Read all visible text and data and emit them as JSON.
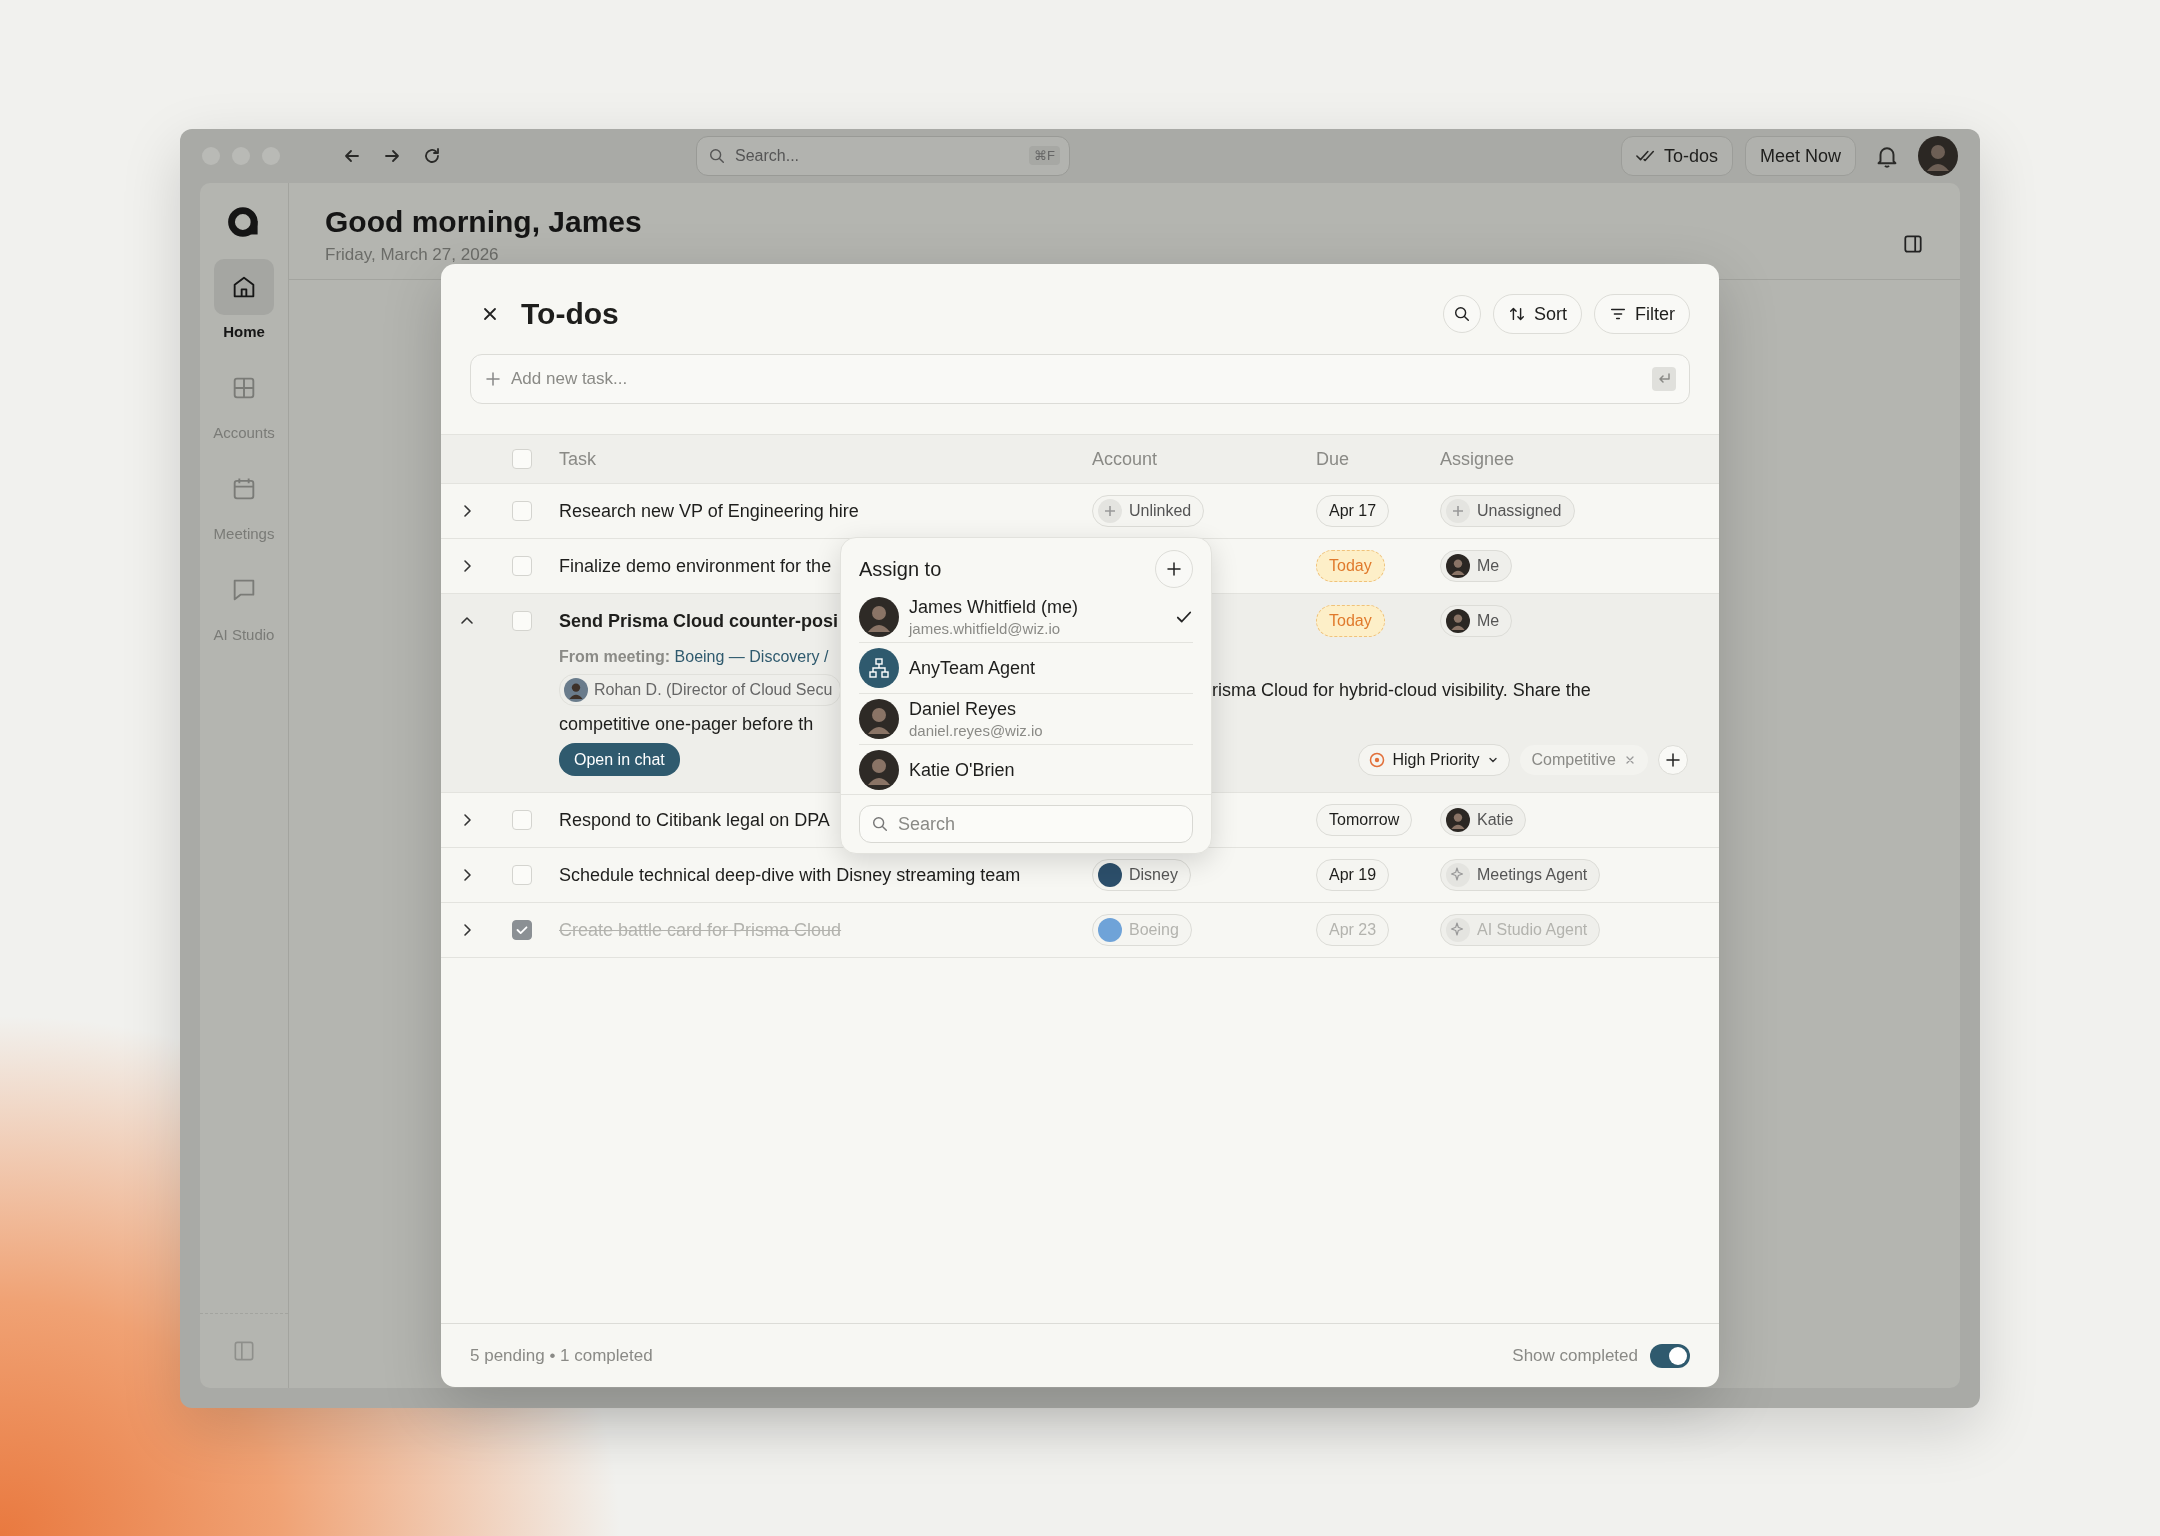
{
  "titlebar": {
    "search": {
      "placeholder": "Search...",
      "shortcut": "⌘F"
    },
    "buttons": [
      {
        "label": "To-dos",
        "kind": "todos"
      },
      {
        "label": "Meet Now",
        "kind": "plain"
      }
    ]
  },
  "sidebar": {
    "items": [
      {
        "label": "Home",
        "kind": "home",
        "selected": true
      },
      {
        "label": "Accounts",
        "kind": "accounts",
        "selected": false
      },
      {
        "label": "Meetings",
        "kind": "meetings",
        "selected": false
      },
      {
        "label": "AI Studio",
        "kind": "chat",
        "selected": false
      }
    ]
  },
  "header": {
    "greeting": "Good morning, James",
    "date": "Friday, March 27, 2026"
  },
  "todos": {
    "title": "To-dos",
    "toolbar": [
      {
        "label": "Sort",
        "kind": "sort"
      },
      {
        "label": "Filter",
        "kind": "filter"
      }
    ],
    "new_task": {
      "placeholder": "Add new task..."
    },
    "columns": [
      "Task",
      "Account",
      "Due",
      "Assignee"
    ],
    "select_all": {
      "checked": false
    },
    "rows": [
      {
        "task": "Research new VP of Engineering hire",
        "checked": false,
        "expanded": false,
        "account": {
          "label": "Unlinked",
          "kind": "unlinked"
        },
        "due": {
          "label": "Apr 17",
          "kind": "date"
        },
        "assignee": {
          "label": "Unassigned",
          "kind": "unassigned"
        }
      },
      {
        "task": "Finalize demo environment for the",
        "checked": false,
        "expanded": false,
        "due": {
          "label": "Today",
          "kind": "today"
        },
        "assignee": {
          "label": "Me",
          "kind": "person"
        }
      },
      {
        "task": "Send Prisma Cloud counter-posi",
        "checked": false,
        "expanded": true,
        "due": {
          "label": "Today",
          "kind": "today"
        },
        "assignee": {
          "label": "Me",
          "kind": "person"
        },
        "details": {
          "meeting_label": "From meeting:",
          "meeting_link": "Boeing — Discovery /",
          "quote_person": "Rohan D. (Director of Cloud Secu",
          "text_right": "risma Cloud for hybrid-cloud visibility. Share the",
          "text_line2": "competitive one-pager before th",
          "action": "Open in chat",
          "priority": "High Priority",
          "tags": [
            "Competitive"
          ]
        }
      },
      {
        "task": "Respond to Citibank legal on DPA",
        "checked": false,
        "expanded": false,
        "due": {
          "label": "Tomorrow",
          "kind": "date"
        },
        "assignee": {
          "label": "Katie",
          "kind": "person"
        }
      },
      {
        "task": "Schedule technical deep-dive with Disney streaming team",
        "checked": false,
        "expanded": false,
        "account": {
          "label": "Disney",
          "kind": "logo",
          "color": "#2c4f6b"
        },
        "due": {
          "label": "Apr 19",
          "kind": "date"
        },
        "assignee": {
          "label": "Meetings Agent",
          "kind": "agent"
        }
      },
      {
        "task": "Create battle card for Prisma Cloud",
        "checked": true,
        "expanded": false,
        "account": {
          "label": "Boeing",
          "kind": "logo",
          "color": "#6fa3d8"
        },
        "due": {
          "label": "Apr 23",
          "kind": "date"
        },
        "assignee": {
          "label": "AI Studio Agent",
          "kind": "agent"
        }
      }
    ],
    "footer": {
      "summary": "5 pending • 1 completed",
      "show_completed": {
        "label": "Show completed",
        "on": true
      }
    }
  },
  "assign_popover": {
    "title": "Assign to",
    "people": [
      {
        "name": "James Whitfield (me)",
        "email": "james.whitfield@wiz.io",
        "kind": "person",
        "selected": true
      },
      {
        "name": "AnyTeam Agent",
        "kind": "agent",
        "selected": false
      },
      {
        "name": "Daniel Reyes",
        "email": "daniel.reyes@wiz.io",
        "kind": "person",
        "selected": false
      },
      {
        "name": "Katie O'Brien",
        "kind": "person",
        "selected": false
      }
    ],
    "search": {
      "placeholder": "Search"
    }
  }
}
